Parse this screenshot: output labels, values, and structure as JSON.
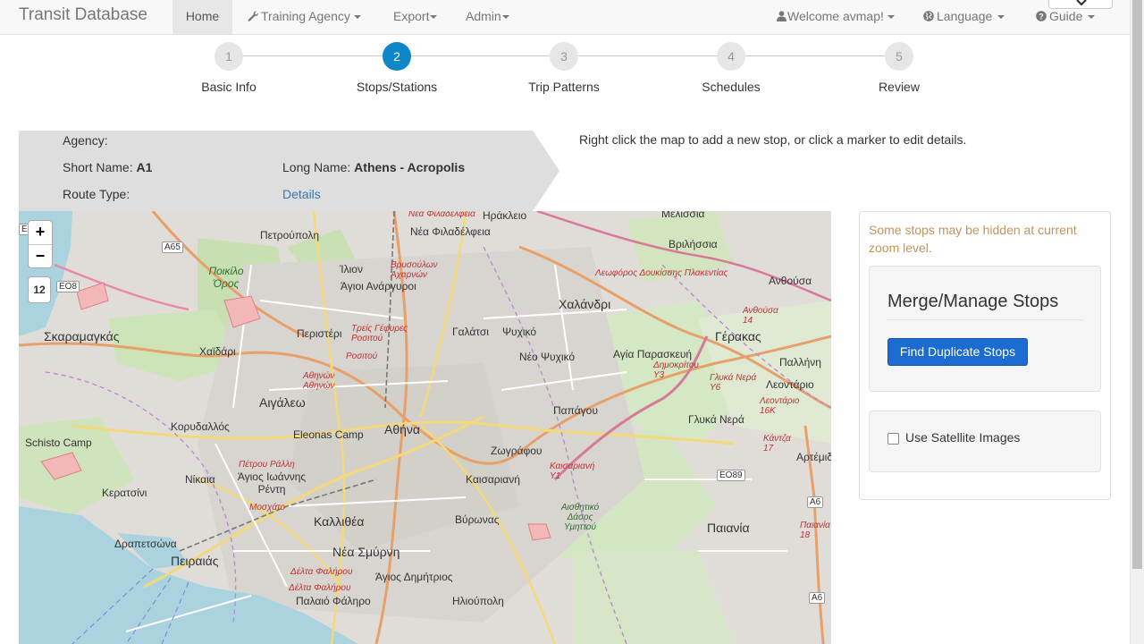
{
  "nav": {
    "brand": "Transit Database",
    "home": "Home",
    "training_agency": "Training Agency",
    "export": "Export",
    "admin": "Admin",
    "welcome": "Welcome avmap!",
    "language": "Language",
    "guide": "Guide"
  },
  "wizard": {
    "current_step": 2,
    "steps": [
      {
        "number": "1",
        "label": "Basic Info"
      },
      {
        "number": "2",
        "label": "Stops/Stations"
      },
      {
        "number": "3",
        "label": "Trip Patterns"
      },
      {
        "number": "4",
        "label": "Schedules"
      },
      {
        "number": "5",
        "label": "Review"
      }
    ]
  },
  "route": {
    "agency_label": "Agency:",
    "agency_value": "",
    "short_name_label": "Short Name:",
    "short_name_value": "A1",
    "long_name_label": "Long Name:",
    "long_name_value": "Athens - Acropolis",
    "route_type_label": "Route Type:",
    "details_link": "Details"
  },
  "hint": "Right click the map to add a new stop, or click a marker to edit details.",
  "map": {
    "zoom_in": "+",
    "zoom_out": "−",
    "zoom_level": "12",
    "labels": {
      "nea_filadelfeia_top": "Νέα Φιλαδέλφεια",
      "iraklio": "Ηράκλειο",
      "melissia": "Μελίσσια",
      "nea_filadelfeia": "Νέα Φιλαδέλφεια",
      "petroupoli": "Πετρούπολη",
      "vrilissia": "Βριλήσσια",
      "poikilo_oros": "Ποικίλο Όρος",
      "ilion": "Ίλιον",
      "vrysoulon": "Βρυσούλων Αχαρνών",
      "agioi_anargyroi": "Άγιοι Ανάργυροι",
      "leoforos_plakentias": "Λεωφόρος Δουκίσσης Πλακεντίας",
      "anthousa": "Ανθούσα",
      "chalandri": "Χαλάνδρι",
      "skaramagkas": "Σκαραμαγκάς",
      "peristeri": "Περιστέρι",
      "treis_gefyres": "Τρείς Γέφυρες Ροσιτού",
      "galatsi": "Γαλάτσι",
      "psychiko": "Ψυχικό",
      "anthousa14": "Ανθούσα 14",
      "gerakas": "Γέρακας",
      "chaidari": "Χαϊδάρι",
      "rositou": "Ροσιτού",
      "neo_psychiko": "Νέο Ψυχικό",
      "agia_paraskevi": "Αγία Παρασκευή",
      "dimokritou": "Δημοκρίτου Υ3",
      "pallini": "Παλλήνη",
      "athinon": "Αθηνών Αθηνών",
      "glyka_nera_y6": "Γλυκά Νερά Υ6",
      "leontario": "Λεοντάριο",
      "aigaleo": "Αιγάλεω",
      "papagou": "Παπάγου",
      "leontario16": "Λεοντάριο 16Κ",
      "athina": "Αθήνα",
      "korydallos": "Κορυδαλλός",
      "eleonas_camp": "Eleonas Camp",
      "glyka_nera": "Γλυκά Νερά",
      "schisto_camp": "Schisto Camp",
      "zografou": "Ζωγράφου",
      "kantza": "Κάντζα 17",
      "artemida": "Αρτέμιδα",
      "petrou_ralli": "Πέτρου Ράλλη",
      "agios_ioannis": "Άγιος Ιωάννης Ρέντη",
      "kaisariani_y1": "Καισαριανή Υ1",
      "nikaia": "Νίκαια",
      "kaisariani": "Καισαριανή",
      "keratsini": "Κερατσίνι",
      "moschato": "Μοσχάτο",
      "aisthitiko": "Αισθητικό Δάσος Υμηττού",
      "kallithea": "Καλλιθέα",
      "vyronas": "Βύρωνας",
      "paiania": "Παιανία",
      "paiania18": "Παιανία 18",
      "drapetsona": "Δραπετσώνα",
      "peiraias": "Πειραιάς",
      "nea_smyrni": "Νέα Σμύρνη",
      "delta_falirou1": "Δέλτα Φαλήρου",
      "agios_dimitrios": "Άγιος Δημήτριος",
      "delta_falirou2": "Δέλτα Φαλήρου",
      "ilioupoli": "Ηλιούπολη",
      "palaio_faliro": "Παλαιό Φάληρο"
    },
    "shields": {
      "eo": "ΕΟ",
      "a65": "A65",
      "eo8": "ΕΟ8",
      "eo89": "ΕΟ89",
      "a6_top": "A6",
      "a6_bottom": "A6"
    }
  },
  "side_panel": {
    "warning": "Some stops may be hidden at current zoom level.",
    "merge_title": "Merge/Manage Stops",
    "find_duplicates": "Find Duplicate Stops",
    "satellite_label": "Use Satellite Images",
    "satellite_checked": false
  }
}
